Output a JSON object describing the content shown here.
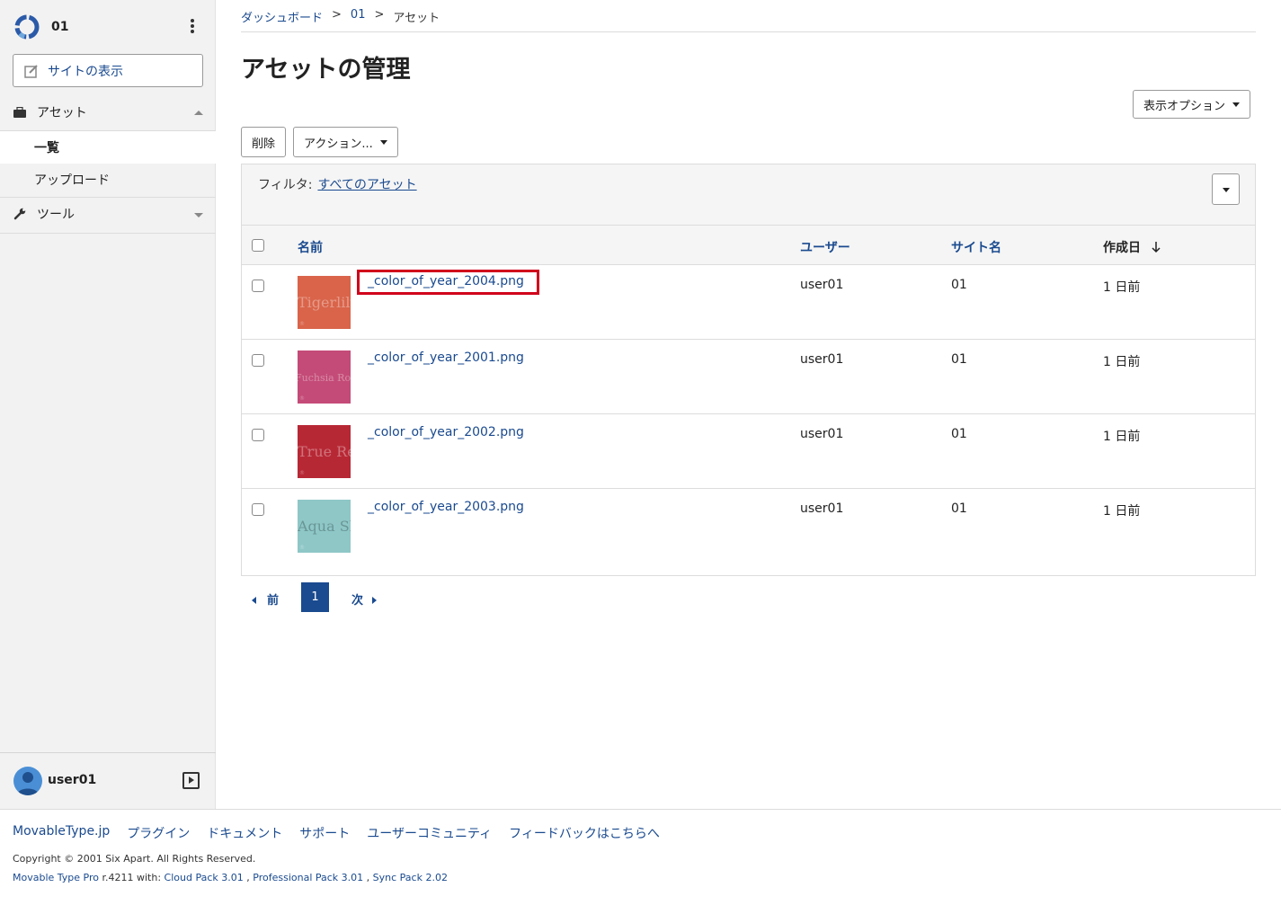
{
  "sidebar": {
    "site_name": "01",
    "view_site_label": "サイトの表示",
    "sections": [
      {
        "label": "アセット",
        "items": [
          {
            "label": "一覧"
          },
          {
            "label": "アップロード"
          }
        ]
      },
      {
        "label": "ツール"
      }
    ],
    "user": "user01"
  },
  "breadcrumb": [
    "ダッシュボード",
    ">",
    "01",
    ">",
    "アセット"
  ],
  "page_title": "アセットの管理",
  "toolbar": {
    "display_options_label": "表示オプション",
    "delete_label": "削除",
    "actions_label": "アクション..."
  },
  "filter": {
    "label": "フィルタ:",
    "value": "すべてのアセット"
  },
  "table": {
    "columns": [
      "名前",
      "ユーザー",
      "サイト名",
      "作成日"
    ],
    "rows": [
      {
        "name": "_color_of_year_2004.png",
        "thumb_text": "Tigerlily",
        "thumb_color": "#d9644a",
        "user": "user01",
        "site": "01",
        "date": "1 日前"
      },
      {
        "name": "_color_of_year_2001.png",
        "thumb_text": "Fuchsia Rose",
        "thumb_color": "#c44b77",
        "user": "user01",
        "site": "01",
        "date": "1 日前"
      },
      {
        "name": "_color_of_year_2002.png",
        "thumb_text": "True Red",
        "thumb_color": "#b72835",
        "user": "user01",
        "site": "01",
        "date": "1 日前"
      },
      {
        "name": "_color_of_year_2003.png",
        "thumb_text": "Aqua Sky",
        "thumb_color": "#8fc7c7",
        "user": "user01",
        "site": "01",
        "date": "1 日前"
      }
    ]
  },
  "pagination": {
    "prev": "前",
    "current": "1",
    "next": "次"
  },
  "footer": {
    "links": [
      "MovableType.jp",
      "プラグイン",
      "ドキュメント",
      "サポート",
      "ユーザーコミュニティ",
      "フィードバックはこちらへ"
    ],
    "copyright": "Copyright © 2001 Six Apart. All Rights Reserved.",
    "product": "Movable Type Pro",
    "version_text": " r.4211 with: ",
    "packs": [
      "Cloud Pack 3.01",
      "Professional Pack 3.01",
      "Sync Pack 2.02"
    ]
  },
  "colors": {
    "accent": "#1a4a8f",
    "highlight": "#d0021b",
    "sidebar_bg": "#f2f2f2"
  }
}
